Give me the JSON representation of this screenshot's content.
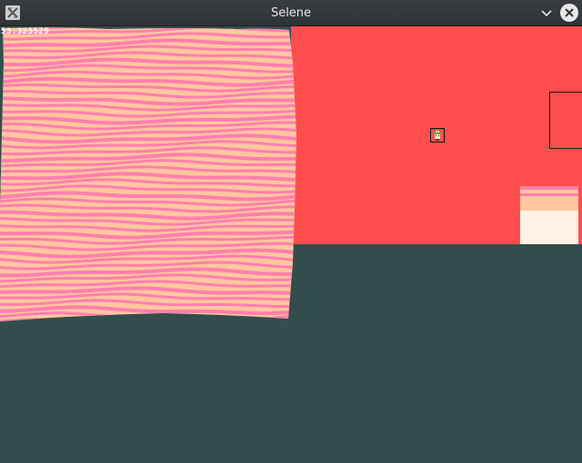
{
  "window": {
    "title": "Selene",
    "app_icon": "x-app-icon",
    "collapse_icon": "chevron-down-icon",
    "close_icon": "close-icon"
  },
  "hud": {
    "fps_readout": "53.323529"
  },
  "scene": {
    "background_color": "#334d4d",
    "room_color": "#ff4d4d",
    "stripe_colors": [
      "#ff7fae",
      "#ffc79e"
    ],
    "cake_frosting_color": "#fff2e6"
  }
}
